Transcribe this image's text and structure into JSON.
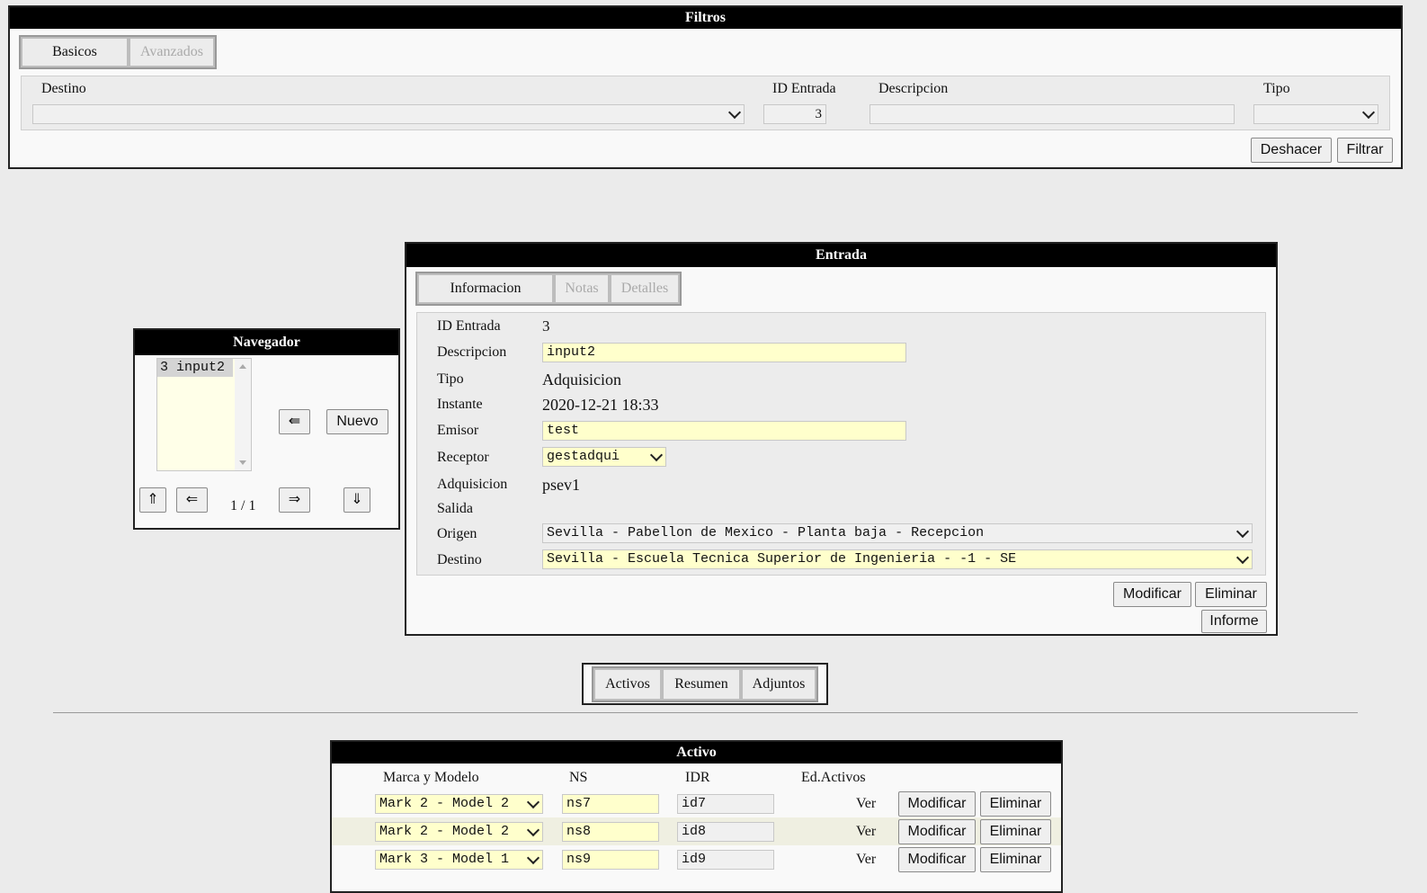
{
  "filtros": {
    "title": "Filtros",
    "tabs": [
      "Basicos",
      "Avanzados"
    ],
    "labels": {
      "destino": "Destino",
      "id_entrada": "ID Entrada",
      "descripcion": "Descripcion",
      "tipo": "Tipo"
    },
    "id_entrada_value": "3",
    "buttons": {
      "deshacer": "Deshacer",
      "filtrar": "Filtrar"
    }
  },
  "navegador": {
    "title": "Navegador",
    "list_item": "3 input2",
    "back_arrow": "⇚",
    "nuevo": "Nuevo",
    "first": "⇑",
    "prev": "⇐",
    "pager": "1 / 1",
    "next": "⇒",
    "last": "⇓"
  },
  "entrada": {
    "title": "Entrada",
    "tabs": [
      "Informacion",
      "Notas",
      "Detalles"
    ],
    "labels": {
      "id_entrada": "ID Entrada",
      "descripcion": "Descripcion",
      "tipo": "Tipo",
      "instante": "Instante",
      "emisor": "Emisor",
      "receptor": "Receptor",
      "adquisicion": "Adquisicion",
      "salida": "Salida",
      "origen": "Origen",
      "destino": "Destino"
    },
    "values": {
      "id_entrada": "3",
      "descripcion": "input2",
      "tipo": "Adquisicion",
      "instante": "2020-12-21 18:33",
      "emisor": "test",
      "receptor": "gestadqui",
      "adquisicion": "psev1",
      "origen": "Sevilla - Pabellon de Mexico - Planta baja - Recepcion",
      "destino": "Sevilla - Escuela Tecnica Superior de Ingenieria - -1 - SE"
    },
    "buttons": {
      "modificar": "Modificar",
      "eliminar": "Eliminar",
      "informe": "Informe"
    }
  },
  "section_tabs": [
    "Activos",
    "Resumen",
    "Adjuntos"
  ],
  "activo": {
    "title": "Activo",
    "columns": [
      "Marca y Modelo",
      "NS",
      "IDR",
      "Ed.Activos"
    ],
    "rows": [
      {
        "marca": "Mark 2 - Model 2",
        "ns": "ns7",
        "idr": "id7",
        "ver": "Ver",
        "modificar": "Modificar",
        "eliminar": "Eliminar"
      },
      {
        "marca": "Mark 2 - Model 2",
        "ns": "ns8",
        "idr": "id8",
        "ver": "Ver",
        "modificar": "Modificar",
        "eliminar": "Eliminar"
      },
      {
        "marca": "Mark 3 - Model 1",
        "ns": "ns9",
        "idr": "id9",
        "ver": "Ver",
        "modificar": "Modificar",
        "eliminar": "Eliminar"
      }
    ]
  }
}
